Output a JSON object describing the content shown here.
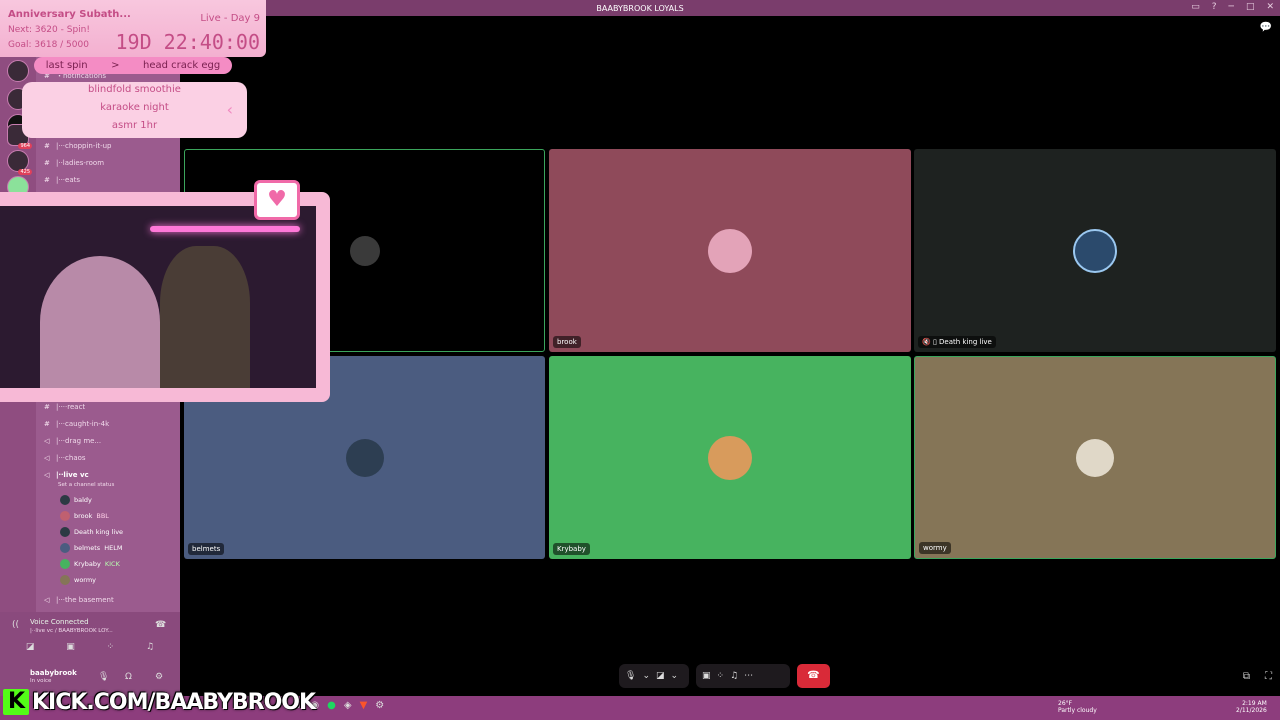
{
  "window": {
    "title": "BAABYBROOK LOYALS"
  },
  "subathon": {
    "title": "Anniversary Subath...",
    "live_day": "Live - Day 9",
    "next": "Next: 3620 - Spin!",
    "goal": "Goal: 3618 / 5000",
    "timer": "19D 22:40:00",
    "last_spin_label": "last spin",
    "last_spin_arrow": ">",
    "last_spin_value": "head crack egg",
    "spin_items": [
      "blindfold smoothie",
      "karaoke night",
      "asmr 1hr"
    ]
  },
  "servers": [
    {
      "badge": ""
    },
    {
      "badge": ""
    },
    {
      "badge": ""
    },
    {
      "badge": "964"
    },
    {
      "badge": "425"
    },
    {
      "badge": ""
    }
  ],
  "channels_top": [
    {
      "icon": "#",
      "label": "・notifications"
    },
    {
      "icon": "#",
      "label": "|‧‧‧choppin-it-up"
    },
    {
      "icon": "#",
      "label": "|‧‧ladies-room"
    },
    {
      "icon": "#",
      "label": "|‧‧‧eats"
    }
  ],
  "channels_bottom": [
    {
      "icon": "#",
      "label": "|‧‧‧‧react"
    },
    {
      "icon": "#",
      "label": "|‧‧‧caught-in-4k"
    },
    {
      "icon": "◁",
      "label": "|‧‧‧drag me..."
    },
    {
      "icon": "◁",
      "label": "|‧‧‧chaos"
    },
    {
      "icon": "◁",
      "label": "|‧‧live vc"
    }
  ],
  "voice": {
    "status": "Set a channel status",
    "members": [
      {
        "name": "baldy",
        "tag": ""
      },
      {
        "name": "brook",
        "tag": "BBL"
      },
      {
        "name": "Death king live",
        "tag": ""
      },
      {
        "name": "belmets",
        "tag": "HELM"
      },
      {
        "name": "Krybaby",
        "tag": "KICK"
      },
      {
        "name": "wormy",
        "tag": ""
      }
    ],
    "basement": "|‧‧‧the basement",
    "connected": "Voice Connected",
    "connected_sub": "|‧‧live vc / BAABYBROOK LOY...",
    "user": "baabybrook",
    "user_status": "In voice"
  },
  "tiles": [
    {
      "name": "",
      "color": "#000000"
    },
    {
      "name": "brook",
      "color": "#8f4a5a"
    },
    {
      "name": "Death king live",
      "color": "#1e2220"
    },
    {
      "name": "belmets",
      "color": "#4b5c80"
    },
    {
      "name": "Krybaby",
      "color": "#47b35f"
    },
    {
      "name": "wormy",
      "color": "#857557"
    }
  ],
  "kick_url": "KICK.COM/BAABYBROOK",
  "taskbar": {
    "weather": "26°F",
    "weather_sub": "Partly cloudy",
    "time": "2:19 AM",
    "date": "2/11/2026"
  },
  "colors": {
    "accent": "#f48cc4",
    "leave": "#d92a38"
  }
}
